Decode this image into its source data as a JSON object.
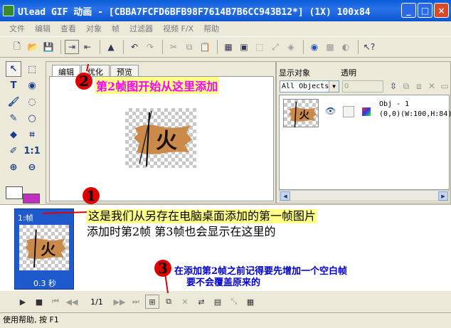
{
  "window": {
    "title": "Ulead GIF 动画 - [CBBA7FCFD6BFB98F7614B7B6CC943B12*] (1X) 100x84"
  },
  "window_buttons": {
    "minimize": "_",
    "maximize": "□",
    "close": "×"
  },
  "menu": [
    "文件",
    "编辑",
    "查看",
    "对象",
    "帧",
    "过滤器",
    "视频 F/X",
    "帮助"
  ],
  "tabs": [
    "编辑",
    "优化",
    "预览"
  ],
  "objects_panel": {
    "show_label": "显示对象",
    "opacity_label": "透明",
    "filter_value": "All Objects",
    "opacity_value": "0",
    "object_name": "Obj - 1",
    "object_coords": "(0,0)(W:100,H:84)"
  },
  "frame": {
    "label": "1:帧",
    "delay": "0.3 秒"
  },
  "playback": {
    "page_indicator": "1/1"
  },
  "status": {
    "text": "使用帮助, 按 F1"
  },
  "canvas_glyph": "火",
  "annotations": {
    "num1": "1",
    "num2": "2",
    "num3": "3",
    "text1_line1": "这是我们从另存在电脑桌面添加的第一帧图片",
    "text1_line2": "添加时第2帧 第3帧也会显示在这里的",
    "text2": "第2帧图开始从这里添加",
    "text3_line1": "在添加第2帧之前记得要先增加一个空白帧",
    "text3_line2": "要不会覆盖原来的"
  },
  "colors": {
    "title_bar": "#0a5bd8",
    "frame_selected": "#1f5acc",
    "annotation_red": "#e00000",
    "annotation_blue": "#0000cc",
    "annotation_pink": "#ff00ff",
    "highlight_yellow": "#ffff88",
    "flag_orange": "#c98a4a"
  }
}
